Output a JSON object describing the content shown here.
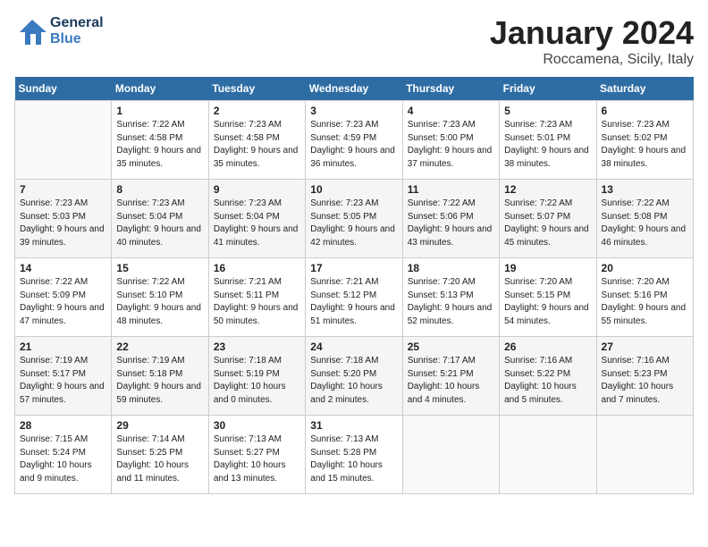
{
  "header": {
    "logo_line1": "General",
    "logo_line2": "Blue",
    "month": "January 2024",
    "location": "Roccamena, Sicily, Italy"
  },
  "days_of_week": [
    "Sunday",
    "Monday",
    "Tuesday",
    "Wednesday",
    "Thursday",
    "Friday",
    "Saturday"
  ],
  "weeks": [
    [
      {
        "day": "",
        "sunrise": "",
        "sunset": "",
        "daylight": ""
      },
      {
        "day": "1",
        "sunrise": "Sunrise: 7:22 AM",
        "sunset": "Sunset: 4:58 PM",
        "daylight": "Daylight: 9 hours and 35 minutes."
      },
      {
        "day": "2",
        "sunrise": "Sunrise: 7:23 AM",
        "sunset": "Sunset: 4:58 PM",
        "daylight": "Daylight: 9 hours and 35 minutes."
      },
      {
        "day": "3",
        "sunrise": "Sunrise: 7:23 AM",
        "sunset": "Sunset: 4:59 PM",
        "daylight": "Daylight: 9 hours and 36 minutes."
      },
      {
        "day": "4",
        "sunrise": "Sunrise: 7:23 AM",
        "sunset": "Sunset: 5:00 PM",
        "daylight": "Daylight: 9 hours and 37 minutes."
      },
      {
        "day": "5",
        "sunrise": "Sunrise: 7:23 AM",
        "sunset": "Sunset: 5:01 PM",
        "daylight": "Daylight: 9 hours and 38 minutes."
      },
      {
        "day": "6",
        "sunrise": "Sunrise: 7:23 AM",
        "sunset": "Sunset: 5:02 PM",
        "daylight": "Daylight: 9 hours and 38 minutes."
      }
    ],
    [
      {
        "day": "7",
        "sunrise": "Sunrise: 7:23 AM",
        "sunset": "Sunset: 5:03 PM",
        "daylight": "Daylight: 9 hours and 39 minutes."
      },
      {
        "day": "8",
        "sunrise": "Sunrise: 7:23 AM",
        "sunset": "Sunset: 5:04 PM",
        "daylight": "Daylight: 9 hours and 40 minutes."
      },
      {
        "day": "9",
        "sunrise": "Sunrise: 7:23 AM",
        "sunset": "Sunset: 5:04 PM",
        "daylight": "Daylight: 9 hours and 41 minutes."
      },
      {
        "day": "10",
        "sunrise": "Sunrise: 7:23 AM",
        "sunset": "Sunset: 5:05 PM",
        "daylight": "Daylight: 9 hours and 42 minutes."
      },
      {
        "day": "11",
        "sunrise": "Sunrise: 7:22 AM",
        "sunset": "Sunset: 5:06 PM",
        "daylight": "Daylight: 9 hours and 43 minutes."
      },
      {
        "day": "12",
        "sunrise": "Sunrise: 7:22 AM",
        "sunset": "Sunset: 5:07 PM",
        "daylight": "Daylight: 9 hours and 45 minutes."
      },
      {
        "day": "13",
        "sunrise": "Sunrise: 7:22 AM",
        "sunset": "Sunset: 5:08 PM",
        "daylight": "Daylight: 9 hours and 46 minutes."
      }
    ],
    [
      {
        "day": "14",
        "sunrise": "Sunrise: 7:22 AM",
        "sunset": "Sunset: 5:09 PM",
        "daylight": "Daylight: 9 hours and 47 minutes."
      },
      {
        "day": "15",
        "sunrise": "Sunrise: 7:22 AM",
        "sunset": "Sunset: 5:10 PM",
        "daylight": "Daylight: 9 hours and 48 minutes."
      },
      {
        "day": "16",
        "sunrise": "Sunrise: 7:21 AM",
        "sunset": "Sunset: 5:11 PM",
        "daylight": "Daylight: 9 hours and 50 minutes."
      },
      {
        "day": "17",
        "sunrise": "Sunrise: 7:21 AM",
        "sunset": "Sunset: 5:12 PM",
        "daylight": "Daylight: 9 hours and 51 minutes."
      },
      {
        "day": "18",
        "sunrise": "Sunrise: 7:20 AM",
        "sunset": "Sunset: 5:13 PM",
        "daylight": "Daylight: 9 hours and 52 minutes."
      },
      {
        "day": "19",
        "sunrise": "Sunrise: 7:20 AM",
        "sunset": "Sunset: 5:15 PM",
        "daylight": "Daylight: 9 hours and 54 minutes."
      },
      {
        "day": "20",
        "sunrise": "Sunrise: 7:20 AM",
        "sunset": "Sunset: 5:16 PM",
        "daylight": "Daylight: 9 hours and 55 minutes."
      }
    ],
    [
      {
        "day": "21",
        "sunrise": "Sunrise: 7:19 AM",
        "sunset": "Sunset: 5:17 PM",
        "daylight": "Daylight: 9 hours and 57 minutes."
      },
      {
        "day": "22",
        "sunrise": "Sunrise: 7:19 AM",
        "sunset": "Sunset: 5:18 PM",
        "daylight": "Daylight: 9 hours and 59 minutes."
      },
      {
        "day": "23",
        "sunrise": "Sunrise: 7:18 AM",
        "sunset": "Sunset: 5:19 PM",
        "daylight": "Daylight: 10 hours and 0 minutes."
      },
      {
        "day": "24",
        "sunrise": "Sunrise: 7:18 AM",
        "sunset": "Sunset: 5:20 PM",
        "daylight": "Daylight: 10 hours and 2 minutes."
      },
      {
        "day": "25",
        "sunrise": "Sunrise: 7:17 AM",
        "sunset": "Sunset: 5:21 PM",
        "daylight": "Daylight: 10 hours and 4 minutes."
      },
      {
        "day": "26",
        "sunrise": "Sunrise: 7:16 AM",
        "sunset": "Sunset: 5:22 PM",
        "daylight": "Daylight: 10 hours and 5 minutes."
      },
      {
        "day": "27",
        "sunrise": "Sunrise: 7:16 AM",
        "sunset": "Sunset: 5:23 PM",
        "daylight": "Daylight: 10 hours and 7 minutes."
      }
    ],
    [
      {
        "day": "28",
        "sunrise": "Sunrise: 7:15 AM",
        "sunset": "Sunset: 5:24 PM",
        "daylight": "Daylight: 10 hours and 9 minutes."
      },
      {
        "day": "29",
        "sunrise": "Sunrise: 7:14 AM",
        "sunset": "Sunset: 5:25 PM",
        "daylight": "Daylight: 10 hours and 11 minutes."
      },
      {
        "day": "30",
        "sunrise": "Sunrise: 7:13 AM",
        "sunset": "Sunset: 5:27 PM",
        "daylight": "Daylight: 10 hours and 13 minutes."
      },
      {
        "day": "31",
        "sunrise": "Sunrise: 7:13 AM",
        "sunset": "Sunset: 5:28 PM",
        "daylight": "Daylight: 10 hours and 15 minutes."
      },
      {
        "day": "",
        "sunrise": "",
        "sunset": "",
        "daylight": ""
      },
      {
        "day": "",
        "sunrise": "",
        "sunset": "",
        "daylight": ""
      },
      {
        "day": "",
        "sunrise": "",
        "sunset": "",
        "daylight": ""
      }
    ]
  ]
}
